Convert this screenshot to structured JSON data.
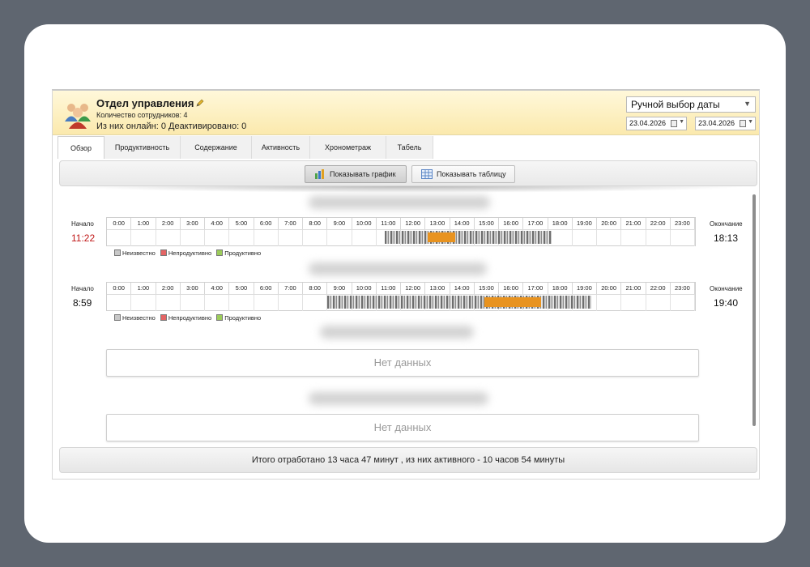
{
  "header": {
    "title": "Отдел управления",
    "employees": "Количество сотрудников: 4",
    "online_status": "Из них онлайн: 0 Деактивировано: 0",
    "date_mode": "Ручной выбор даты",
    "date_from": "23.04.2026",
    "date_to": "23.04.2026"
  },
  "tabs": [
    {
      "label": "Обзор",
      "active": true
    },
    {
      "label": "Продуктивность"
    },
    {
      "label": "Содержание"
    },
    {
      "label": "Активность"
    },
    {
      "label": "Хронометраж"
    },
    {
      "label": "Табель"
    }
  ],
  "toolbar": {
    "show_chart": "Показывать график",
    "show_table": "Показывать таблицу"
  },
  "hours": [
    "0:00",
    "1:00",
    "2:00",
    "3:00",
    "4:00",
    "5:00",
    "6:00",
    "7:00",
    "8:00",
    "9:00",
    "10:00",
    "11:00",
    "12:00",
    "13:00",
    "14:00",
    "15:00",
    "16:00",
    "17:00",
    "18:00",
    "19:00",
    "20:00",
    "21:00",
    "22:00",
    "23:00"
  ],
  "rows": [
    {
      "start_label": "Начало",
      "start": "11:22",
      "end_label": "Окончание",
      "end": "18:13"
    },
    {
      "start_label": "Начало",
      "start": "8:59",
      "end_label": "Окончание",
      "end": "19:40"
    }
  ],
  "legend": {
    "unknown": "Неизвестно",
    "unproductive": "Непродуктивно",
    "productive": "Продуктивно"
  },
  "colors": {
    "unknown": "#c8c8c8",
    "unproductive": "#e46464",
    "productive": "#9ccc5a",
    "activity": "#e89320"
  },
  "no_data": "Нет данных",
  "footer": "Итого отработано 13 часа 47 минут , из них активного - 10 часов 54 минуты"
}
